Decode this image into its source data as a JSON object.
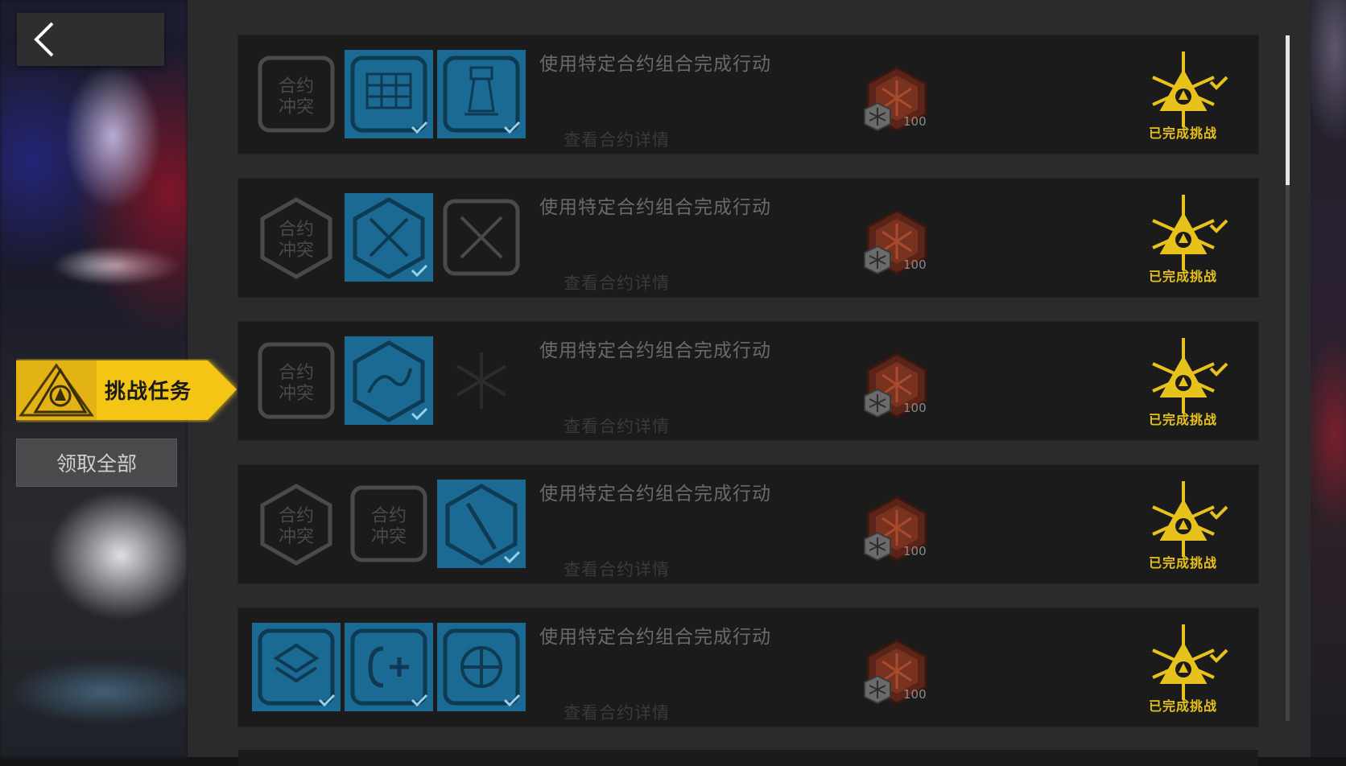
{
  "header": {
    "back_icon": "chevron-left-icon"
  },
  "sidebar": {
    "challenge_tab_label": "挑战任务",
    "claim_all_label": "领取全部",
    "accent_color": "#f5c518"
  },
  "tasks": [
    {
      "title": "使用特定合约组合完成行动",
      "link": "查看合约详情",
      "reward_count": "100",
      "status": "已完成挑战",
      "icons": [
        {
          "name": "contract-conflict-icon",
          "active": false,
          "text1": "合约",
          "text2": "冲突"
        },
        {
          "name": "grid-cross-icon",
          "active": true
        },
        {
          "name": "tower-one-icon",
          "active": true
        }
      ]
    },
    {
      "title": "使用特定合约组合完成行动",
      "link": "查看合约详情",
      "reward_count": "100",
      "status": "已完成挑战",
      "icons": [
        {
          "name": "contract-conflict-hex-icon",
          "active": false,
          "text1": "合约",
          "text2": "冲突"
        },
        {
          "name": "crossed-swords-icon",
          "active": true
        },
        {
          "name": "crossed-swords-outline-icon",
          "active": false
        }
      ]
    },
    {
      "title": "使用特定合约组合完成行动",
      "link": "查看合约详情",
      "reward_count": "100",
      "status": "已完成挑战",
      "icons": [
        {
          "name": "contract-conflict-icon",
          "active": false,
          "text1": "合约",
          "text2": "冲突"
        },
        {
          "name": "creature-hex-icon",
          "active": true
        },
        {
          "name": "snowflake-icon",
          "active": false
        }
      ]
    },
    {
      "title": "使用特定合约组合完成行动",
      "link": "查看合约详情",
      "reward_count": "100",
      "status": "已完成挑战",
      "icons": [
        {
          "name": "contract-conflict-hex-icon",
          "active": false,
          "text1": "合约",
          "text2": "冲突"
        },
        {
          "name": "contract-conflict-tower-icon",
          "active": false,
          "text1": "合约",
          "text2": "冲突"
        },
        {
          "name": "sword-hex-icon",
          "active": true
        }
      ]
    },
    {
      "title": "使用特定合约组合完成行动",
      "link": "查看合约详情",
      "reward_count": "100",
      "status": "已完成挑战",
      "icons": [
        {
          "name": "shield-layers-icon",
          "active": true
        },
        {
          "name": "cost-plus-icon",
          "active": true
        },
        {
          "name": "target-grid-icon",
          "active": true
        }
      ]
    }
  ]
}
